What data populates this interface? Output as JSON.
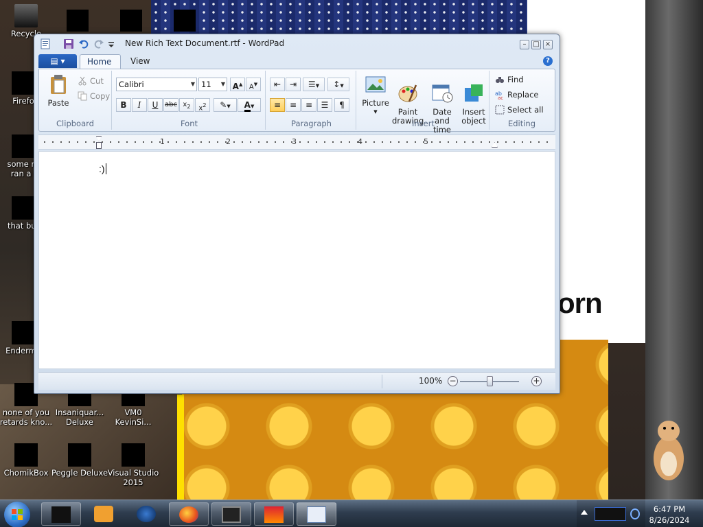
{
  "desktop": {
    "icons": [
      {
        "label": "Recycle"
      },
      {
        "label": "Firefo"
      },
      {
        "label": "some ru\nran a i"
      },
      {
        "label": "that but"
      },
      {
        "label": "Enderma"
      },
      {
        "label": "none of you\nretards kno..."
      },
      {
        "label": "Insaniquar...\nDeluxe"
      },
      {
        "label": "VM0\nKevinSi..."
      },
      {
        "label": "ChomikBox"
      },
      {
        "label": "Peggle Deluxe"
      },
      {
        "label": "Visual Studio\n2015"
      }
    ],
    "wallpaper_text": "orn"
  },
  "window": {
    "title": "New Rich Text Document.rtf - WordPad",
    "tabs": [
      {
        "label": "Home"
      },
      {
        "label": "View"
      }
    ],
    "ribbon": {
      "clipboard": {
        "group_label": "Clipboard",
        "paste": "Paste",
        "cut": "Cut",
        "copy": "Copy"
      },
      "font": {
        "group_label": "Font",
        "family": "Calibri",
        "size": "11"
      },
      "paragraph": {
        "group_label": "Paragraph"
      },
      "insert": {
        "group_label": "Insert",
        "picture": "Picture",
        "paint_drawing": "Paint\ndrawing",
        "date_time": "Date and\ntime",
        "insert_object": "Insert\nobject"
      },
      "editing": {
        "group_label": "Editing",
        "find": "Find",
        "replace": "Replace",
        "select_all": "Select all"
      }
    },
    "ruler": {
      "marks": [
        "1",
        "2",
        "3",
        "4",
        "5"
      ]
    },
    "document": {
      "text": ":)"
    },
    "status": {
      "zoom": "100%",
      "zoom_level": 0.5
    }
  },
  "taskbar": {
    "time": "6:47 PM",
    "date": "8/26/2024"
  },
  "colors": {
    "accent": "#2a67c4",
    "taskbar": "#2f3d4f"
  }
}
